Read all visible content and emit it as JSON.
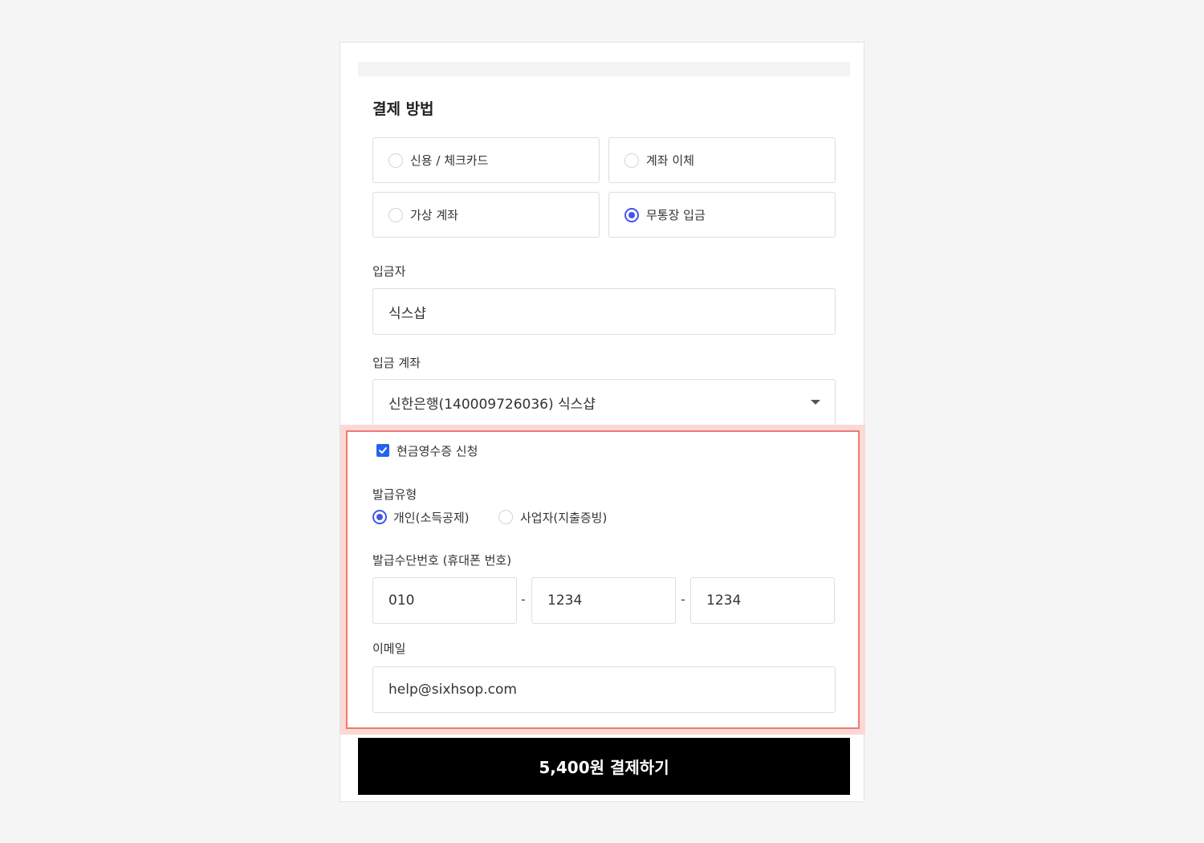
{
  "payment": {
    "section_title": "결제 방법",
    "methods": [
      {
        "label": "신용 / 체크카드",
        "selected": false
      },
      {
        "label": "계좌 이체",
        "selected": false
      },
      {
        "label": "가상 계좌",
        "selected": false
      },
      {
        "label": "무통장 입금",
        "selected": true
      }
    ],
    "depositor_label": "입금자",
    "depositor_value": "식스샵",
    "account_label": "입금 계좌",
    "account_value": "신한은행(140009726036) 식스샵"
  },
  "receipt": {
    "checkbox_label": "현금영수증 신청",
    "checked": true,
    "type_label": "발급유형",
    "types": [
      {
        "label": "개인(소득공제)",
        "selected": true
      },
      {
        "label": "사업자(지출증빙)",
        "selected": false
      }
    ],
    "phone_label": "발급수단번호 (휴대폰 번호)",
    "phone": [
      "010",
      "1234",
      "1234"
    ],
    "dash": "-",
    "email_label": "이메일",
    "email_value": "help@sixhsop.com"
  },
  "pay_button": "5,400원 결제하기",
  "colors": {
    "accent": "#4356e8",
    "highlight_border": "#f07a70",
    "highlight_fill": "#fbd9d6",
    "button_bg": "#000000"
  }
}
